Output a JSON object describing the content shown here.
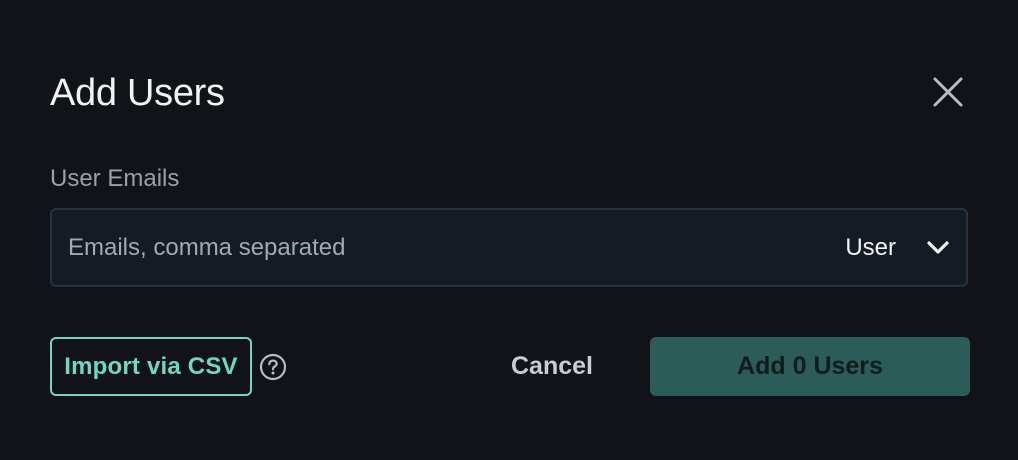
{
  "dialog": {
    "title": "Add Users",
    "close_icon": "close-icon"
  },
  "emails": {
    "label": "User Emails",
    "value": "",
    "placeholder": "Emails, comma separated"
  },
  "role": {
    "selected": "User",
    "icon": "chevron-down-icon"
  },
  "actions": {
    "import_csv_label": "Import via CSV",
    "help_icon": "question-circle-icon",
    "cancel_label": "Cancel",
    "add_label": "Add 0 Users"
  },
  "colors": {
    "background": "#111318",
    "accent": "#6fd8c2",
    "primary_disabled": "#2c5c57"
  }
}
